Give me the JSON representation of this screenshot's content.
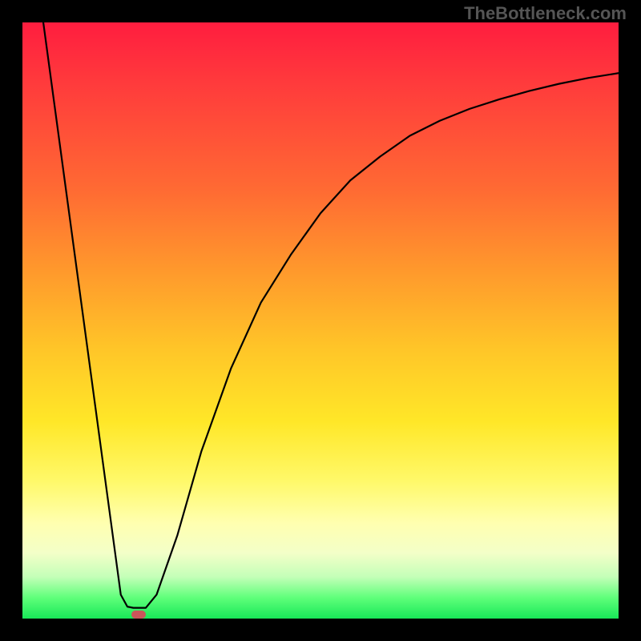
{
  "watermark": "TheBottleneck.com",
  "chart_data": {
    "type": "line",
    "title": "",
    "xlabel": "",
    "ylabel": "",
    "xlim": [
      0,
      1
    ],
    "ylim": [
      0,
      1
    ],
    "grid": false,
    "legend": false,
    "series": [
      {
        "name": "curve",
        "x": [
          0.035,
          0.165,
          0.176,
          0.186,
          0.204,
          0.207,
          0.225,
          0.26,
          0.3,
          0.35,
          0.4,
          0.45,
          0.5,
          0.55,
          0.6,
          0.65,
          0.7,
          0.75,
          0.8,
          0.85,
          0.9,
          0.95,
          1.0
        ],
        "y": [
          1.0,
          0.04,
          0.02,
          0.018,
          0.018,
          0.018,
          0.04,
          0.14,
          0.28,
          0.42,
          0.53,
          0.61,
          0.68,
          0.735,
          0.775,
          0.81,
          0.835,
          0.855,
          0.871,
          0.885,
          0.897,
          0.907,
          0.915
        ]
      }
    ],
    "marker": {
      "x": 0.195,
      "y": 0.0
    },
    "background_gradient": {
      "stops": [
        {
          "pos": 0.0,
          "color": "#ff1d3f"
        },
        {
          "pos": 0.28,
          "color": "#ff6a33"
        },
        {
          "pos": 0.55,
          "color": "#ffc628"
        },
        {
          "pos": 0.77,
          "color": "#fff96a"
        },
        {
          "pos": 0.93,
          "color": "#c4ffb8"
        },
        {
          "pos": 1.0,
          "color": "#18e858"
        }
      ]
    }
  }
}
